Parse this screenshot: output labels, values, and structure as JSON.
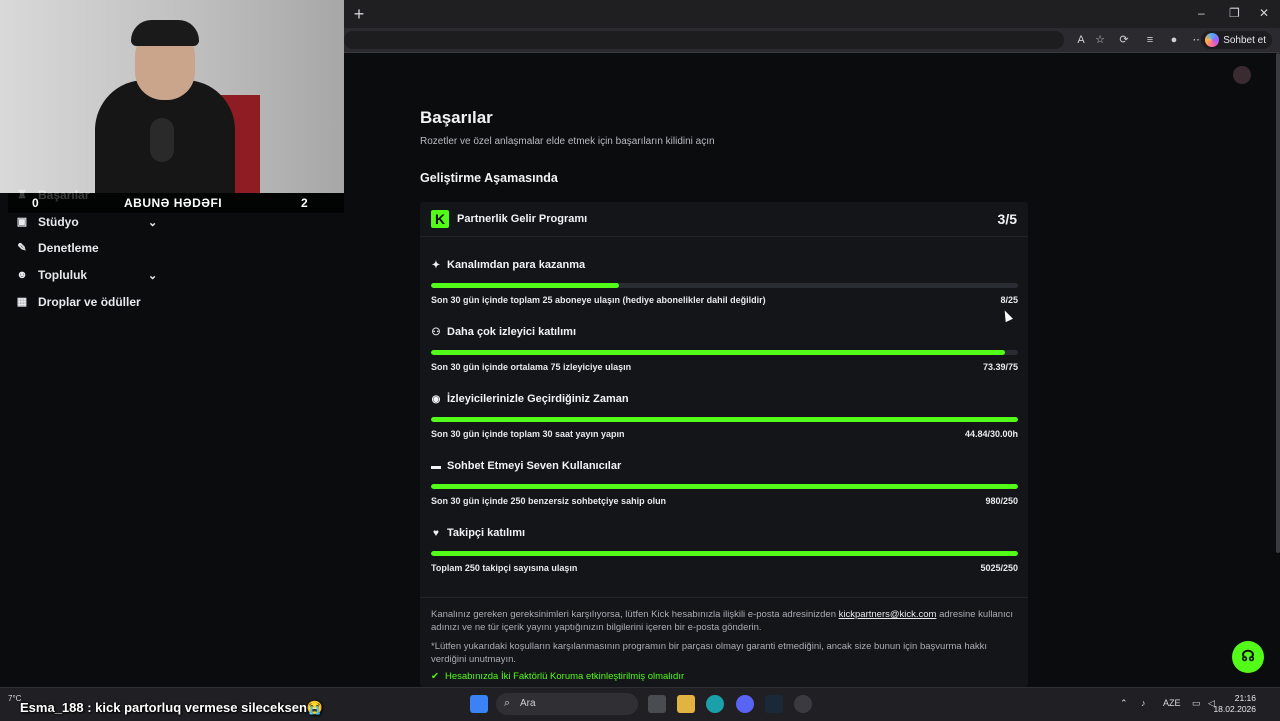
{
  "browser": {
    "new_tab": "+",
    "copilot_label": "Sohbet et",
    "window_controls": [
      "–",
      "❐",
      "✕"
    ]
  },
  "overlay": {
    "sub_goal_current": "0",
    "sub_goal_label": "ABUNƏ HƏDƏFI",
    "sub_goal_target": "2",
    "chat_message": "Esma_188 : kick partorluq vermese sileceksen😭"
  },
  "sidebar": {
    "items": [
      {
        "label": "Başarılar",
        "icon": "trophy-icon"
      },
      {
        "label": "Stüdyo",
        "icon": "studio-icon",
        "expandable": true
      },
      {
        "label": "Denetleme",
        "icon": "wrench-icon"
      },
      {
        "label": "Topluluk",
        "icon": "community-icon",
        "expandable": true
      },
      {
        "label": "Droplar ve ödüller",
        "icon": "gift-icon"
      }
    ]
  },
  "main": {
    "title": "Başarılar",
    "subtitle": "Rozetler ve özel anlaşmalar elde etmek için başarıların kilidini açın",
    "section": "Geliştirme Aşamasında",
    "program": {
      "logo_letter": "K",
      "title": "Partnerlik Gelir Programı",
      "count": "3/5",
      "requirements": [
        {
          "icon": "sparkle-icon",
          "title": "Kanalımdan para kazanma",
          "desc": "Son 30 gün içinde toplam 25 aboneye ulaşın (hediye abonelikler dahil değildir)",
          "value": "8/25",
          "progress": 0.32
        },
        {
          "icon": "users-icon",
          "title": "Daha çok izleyici katılımı",
          "desc": "Son 30 gün içinde ortalama 75 izleyiciye ulaşın",
          "value": "73.39/75",
          "progress": 0.9785
        },
        {
          "icon": "broadcast-icon",
          "title": "İzleyicilerinizle Geçirdiğiniz Zaman",
          "desc": "Son 30 gün içinde toplam 30 saat yayın yapın",
          "value": "44.84/30.00h",
          "progress": 1.0
        },
        {
          "icon": "chat-icon",
          "title": "Sohbet Etmeyi Seven Kullanıcılar",
          "desc": "Son 30 gün içinde 250 benzersiz sohbetçiye sahip olun",
          "value": "980/250",
          "progress": 1.0
        },
        {
          "icon": "heart-icon",
          "title": "Takipçi katılımı",
          "desc": "Toplam 250 takipçi sayısına ulaşın",
          "value": "5025/250",
          "progress": 1.0
        }
      ],
      "footer_text_1a": "Kanalınız gereken gereksinimleri karşılıyorsa, lütfen Kick hesabınızla ilişkili e-posta adresinizden ",
      "footer_email": "kickpartners@kick.com",
      "footer_text_1b": " adresine kullanıcı adınızı ve ne tür içerik yayını yaptığınızın bilgilerini içeren bir e-posta gönderin.",
      "footer_text_2": "*Lütfen yukarıdaki koşulların karşılanmasının programın bir parçası olmayı garanti etmediğini, ancak size bunun için başvurma hakkı verdiğini unutmayın.",
      "footer_check": "Hesabınızda İki Faktörlü Koruma etkinleştirilmiş olmalıdır"
    }
  },
  "taskbar": {
    "weather": "7°C",
    "search_placeholder": "Ara",
    "language": "AZE",
    "time": "21:16",
    "date": "18.02.2026"
  },
  "colors": {
    "accent": "#53fc18",
    "card_bg": "#141519",
    "page_bg": "#0b0c0e"
  }
}
